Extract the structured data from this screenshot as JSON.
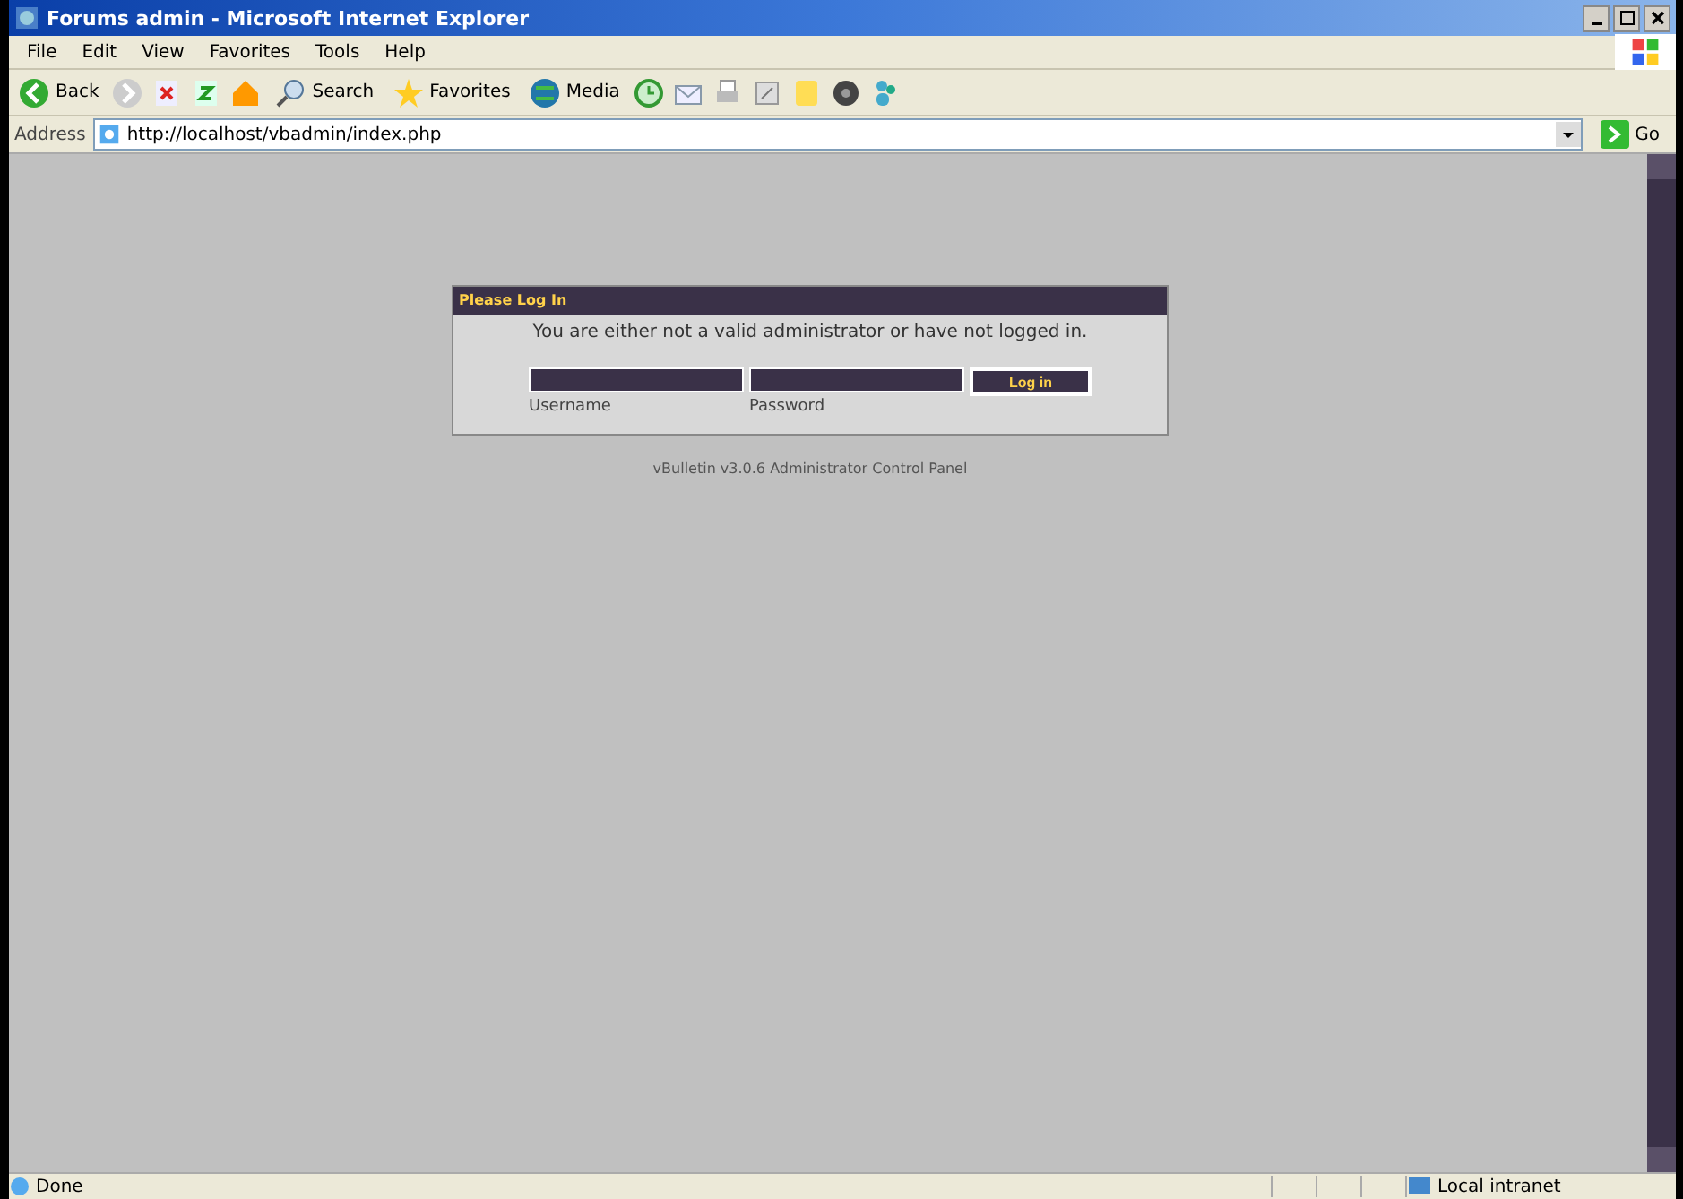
{
  "window": {
    "title": "Forums admin - Microsoft Internet Explorer"
  },
  "menu": [
    "File",
    "Edit",
    "View",
    "Favorites",
    "Tools",
    "Help"
  ],
  "toolbar": {
    "back": "Back",
    "search": "Search",
    "favorites": "Favorites",
    "media": "Media"
  },
  "address": {
    "label": "Address",
    "value": "http://localhost/vbadmin/index.php",
    "go": "Go"
  },
  "login": {
    "header": "Please Log In",
    "message": "You are either not a valid administrator or have not logged in.",
    "username_label": "Username",
    "password_label": "Password",
    "button": "Log in"
  },
  "footer": "vBulletin v3.0.6 Administrator Control Panel",
  "status_bar": {
    "status": "Done",
    "zone": "Local intranet"
  }
}
